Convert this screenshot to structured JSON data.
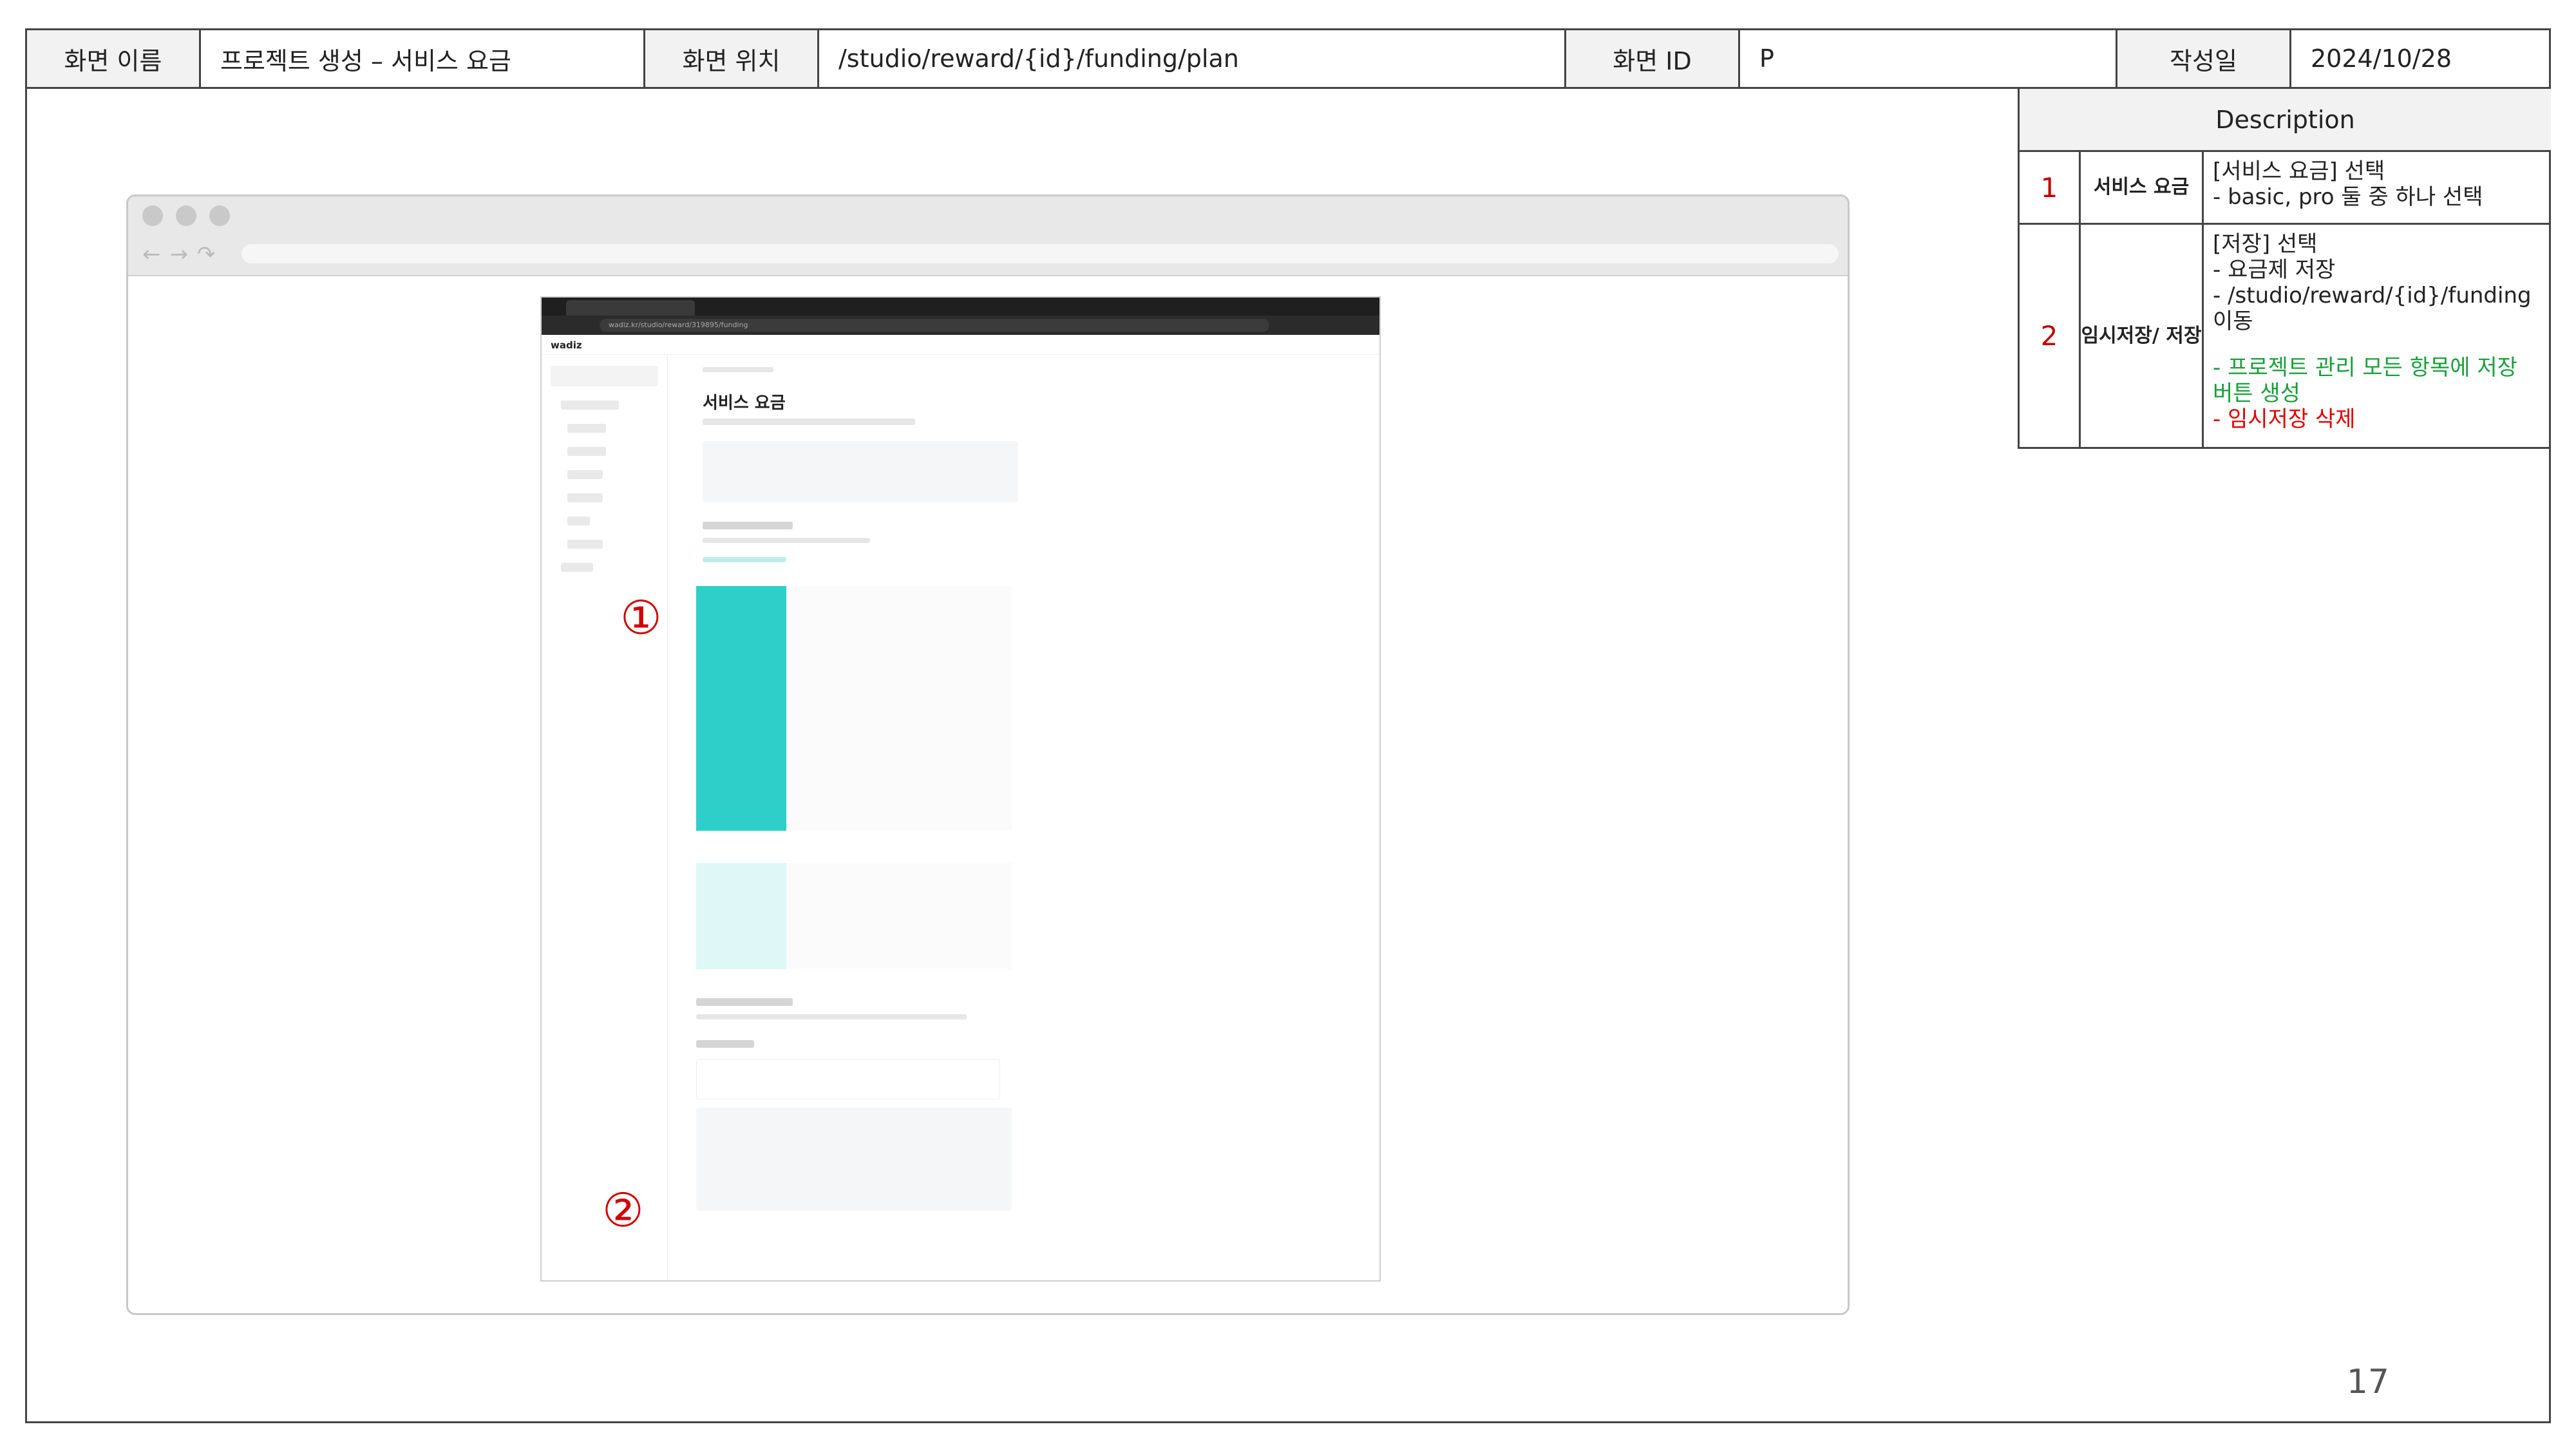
{
  "header": {
    "screen_name_label": "화면 이름",
    "screen_name": "프로젝트 생성 – 서비스 요금",
    "screen_location_label": "화면 위치",
    "screen_location": "/studio/reward/{id}/funding/plan",
    "screen_id_label": "화면 ID",
    "screen_id": "P",
    "date_label": "작성일",
    "date": "2024/10/28"
  },
  "description": {
    "title": "Description",
    "rows": [
      {
        "num": "1",
        "name": "서비스 요금",
        "lines": [
          "[서비스 요금] 선택",
          "- basic, pro 둘 중 하나 선택"
        ]
      },
      {
        "num": "2",
        "name": "임시저장/ 저장",
        "lines": [
          "[저장] 선택",
          "- 요금제 저장",
          "- /studio/reward/{id}/funding 이동"
        ],
        "green": "- 프로젝트 관리 모든 항목에 저장 버튼 생성",
        "red": "- 임시저장 삭제"
      }
    ]
  },
  "screenshot": {
    "url": "wadiz.kr/studio/reward/319895/funding",
    "logo": "wadiz",
    "page_title": "서비스 요금"
  },
  "markers": [
    "①",
    "②"
  ],
  "page_number": "17"
}
